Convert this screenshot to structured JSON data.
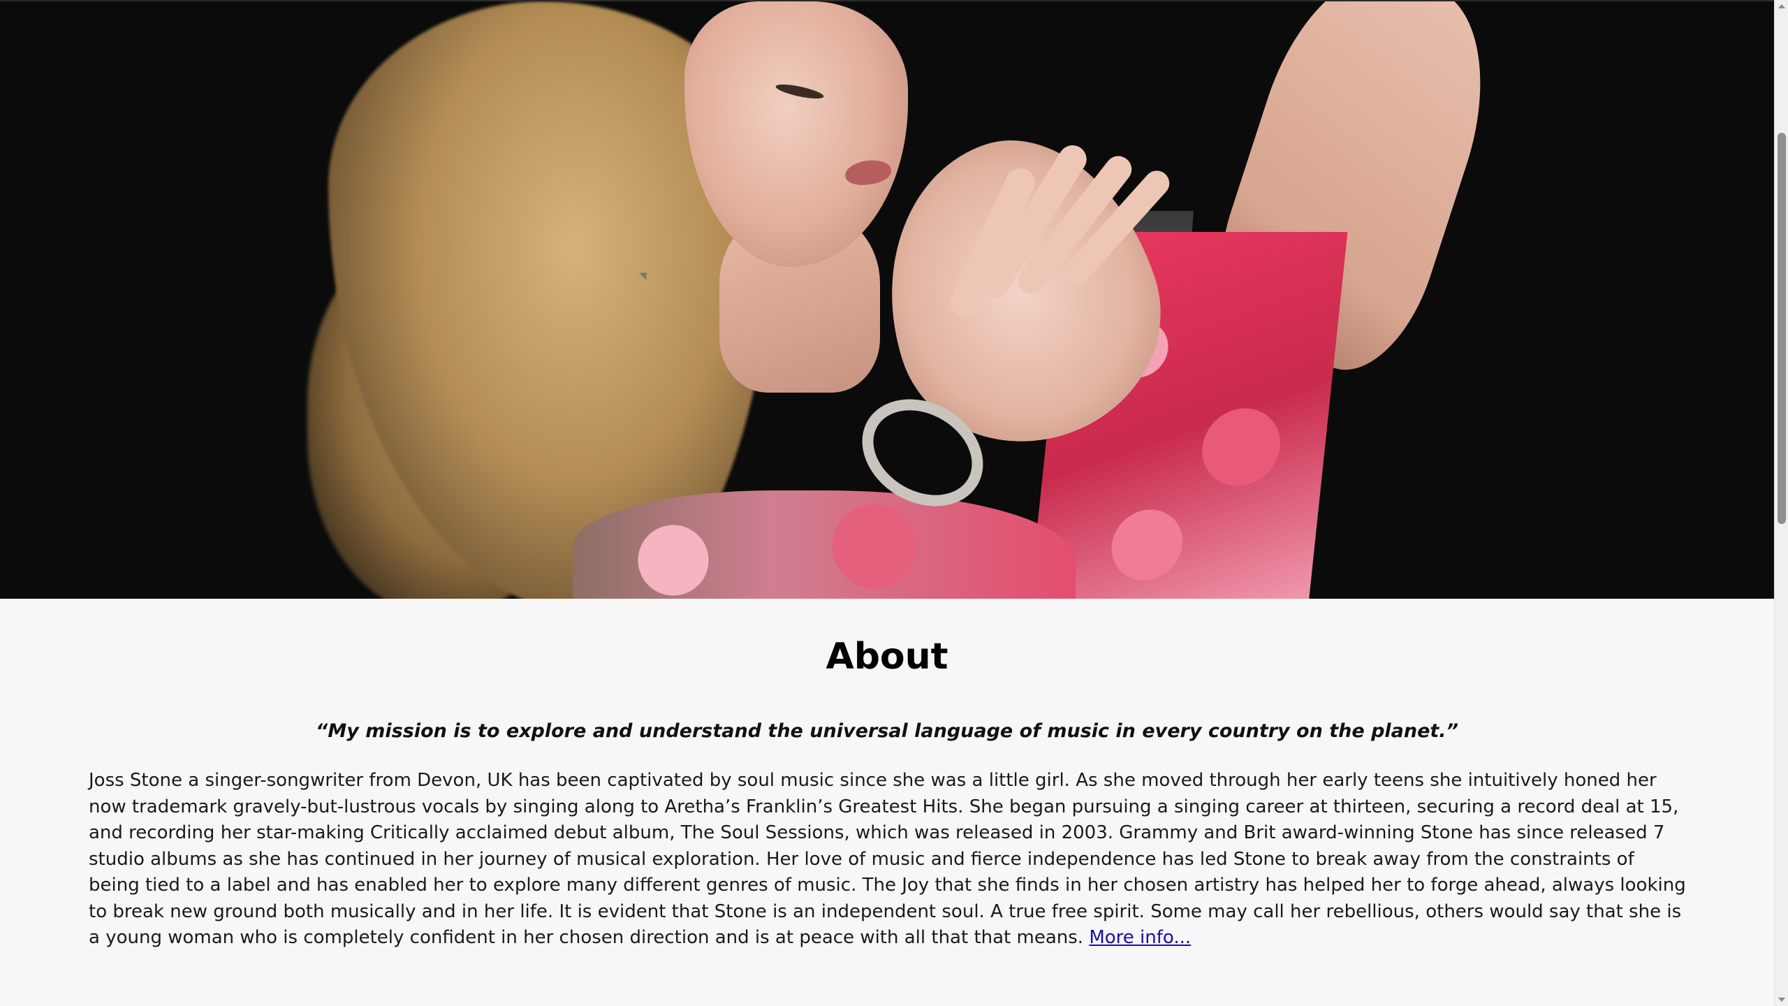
{
  "hero": {
    "image_alt_name": "artist-portrait-photo"
  },
  "about": {
    "heading": "About",
    "quote": "“My mission is to explore and understand the universal language of music in every country on the planet.”",
    "bio": "Joss Stone a singer-songwriter from Devon, UK has been captivated by soul music since she was a little girl. As she moved through her early teens she intuitively honed her now trademark gravely-but-lustrous vocals by singing along to Aretha’s Franklin’s Greatest Hits. She began pursuing a singing career at thirteen, securing a record deal at 15, and recording her star-making Critically acclaimed debut album, The Soul Sessions, which was released in 2003. Grammy and Brit award-winning Stone has since released 7 studio albums as she has continued in her journey of musical exploration. Her love of music and fierce independence has led Stone to break away from the constraints of being tied to a label and has enabled her to explore many different genres of music. The Joy that she finds in her chosen artistry has helped her to forge ahead, always looking to break new ground both musically and in her life. It is evident that Stone is an independent soul. A true free spirit. Some may call her rebellious, others would say that she is a young woman who is completely confident in her chosen direction and is at peace with all that that means.",
    "more_link": "More info..."
  },
  "colors": {
    "background": "#f7f7f7",
    "link": "#1a0dab",
    "hero_background": "#0b0b0b"
  }
}
